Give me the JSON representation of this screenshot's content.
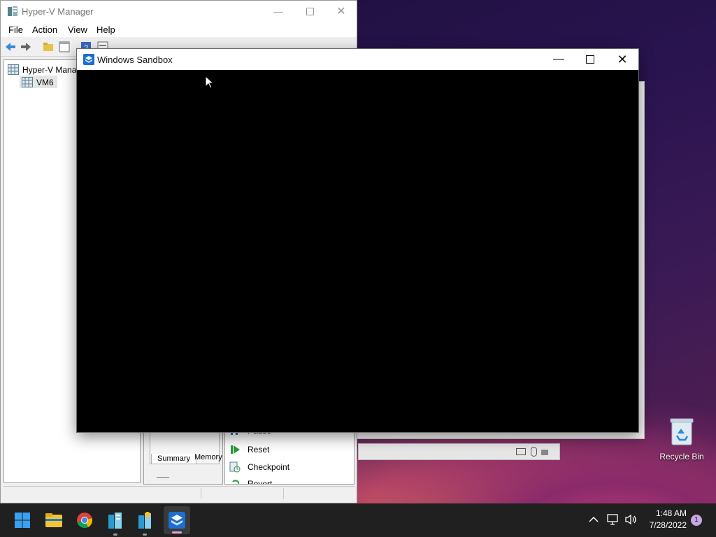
{
  "hyperv": {
    "title": "Hyper-V Manager",
    "menu": [
      "File",
      "Action",
      "View",
      "Help"
    ],
    "tree_root": "Hyper-V Mana",
    "tree_vm": "VM6",
    "tabs": [
      "Summary",
      "Memory"
    ],
    "actions": [
      "Pause",
      "Reset",
      "Checkpoint",
      "Revert"
    ]
  },
  "sandbox": {
    "title": "Windows Sandbox"
  },
  "desktop": {
    "recycle_bin": "Recycle Bin"
  },
  "taskbar": {
    "time": "1:48 AM",
    "date": "7/28/2022",
    "notification_count": "1",
    "icons": [
      "windows-start-icon",
      "file-explorer-icon",
      "chrome-icon",
      "hyperv-manager-icon",
      "vm-connection-icon",
      "windows-sandbox-icon"
    ]
  },
  "colors": {
    "accent": "#0067c0",
    "taskbar": "#202020",
    "notification_badge": "#c8a6e6"
  }
}
